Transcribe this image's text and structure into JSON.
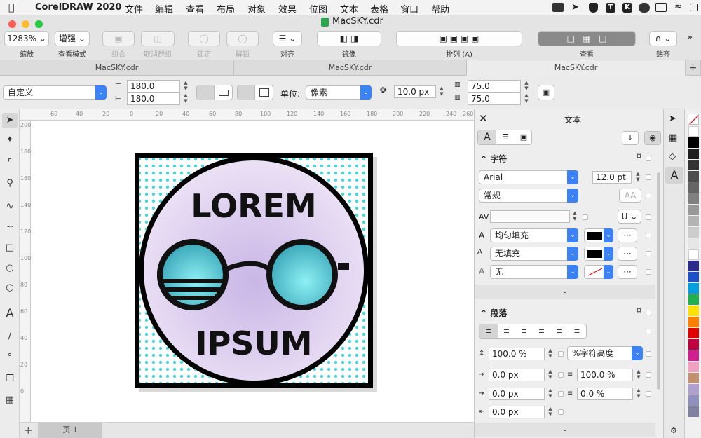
{
  "menubar": {
    "app": "CorelDRAW 2020",
    "items": [
      "文件",
      "编辑",
      "查看",
      "布局",
      "对象",
      "效果",
      "位图",
      "文本",
      "表格",
      "窗口",
      "帮助"
    ]
  },
  "title": "MacSKY.cdr",
  "toolbar": {
    "zoom": "1283%",
    "view_mode": "增强",
    "labels": {
      "zoom": "缩放",
      "view_mode": "查看模式",
      "group": "组合",
      "ungroup": "取消群组",
      "lock": "锁定",
      "unlock": "解锁",
      "align": "对齐",
      "mirror": "镜像",
      "arrange": "排列 (A)",
      "view": "查看",
      "snap": "贴齐"
    }
  },
  "tabs": [
    "MacSKY.cdr",
    "MacSKY.cdr",
    "MacSKY.cdr"
  ],
  "propbar": {
    "preset": "自定义",
    "width": "180.0",
    "height": "180.0",
    "unit_label": "单位:",
    "unit": "像素",
    "nudge": "10.0 px",
    "dup_x": "75.0",
    "dup_y": "75.0"
  },
  "ruler_h": [
    "60",
    "40",
    "20",
    "0",
    "20",
    "40",
    "60",
    "80",
    "100",
    "120",
    "140",
    "160",
    "180",
    "200",
    "220",
    "240",
    "260"
  ],
  "ruler_v": [
    "200",
    "180",
    "160",
    "140",
    "120",
    "100",
    "80",
    "60",
    "40",
    "20",
    "0"
  ],
  "artwork": {
    "top_text": "LOREM",
    "bottom_text": "IPSUM"
  },
  "page_tab": "页 1",
  "docker": {
    "title": "文本",
    "char_section": "字符",
    "font": "Arial",
    "size": "12.0 pt",
    "style": "常规",
    "fill": "均匀填充",
    "bg_fill": "无填充",
    "outline": "无",
    "para_section": "段落",
    "line_spacing": "100.0 %",
    "line_spacing_unit": "%字符高度",
    "indent_left": "0.0 px",
    "char_spacing": "100.0 %",
    "indent_first": "0.0 px",
    "word_spacing": "0.0 %",
    "indent_right": "0.0 px"
  },
  "colors": {
    "accent": "#3b82f6",
    "palette": [
      "#ffffff",
      "#000000",
      "#1f1f1f",
      "#333333",
      "#4d4d4d",
      "#666666",
      "#808080",
      "#999999",
      "#b3b3b3",
      "#cccccc",
      "#e6e6e6",
      "#ffffff",
      "#2c2c8c",
      "#1e50c8",
      "#00a0e0",
      "#20b050",
      "#ffe000",
      "#ff8000",
      "#e00000",
      "#c00040",
      "#d02090",
      "#f0a0c0",
      "#c09070",
      "#b0a0d0",
      "#9090c0",
      "#8080a0"
    ]
  }
}
